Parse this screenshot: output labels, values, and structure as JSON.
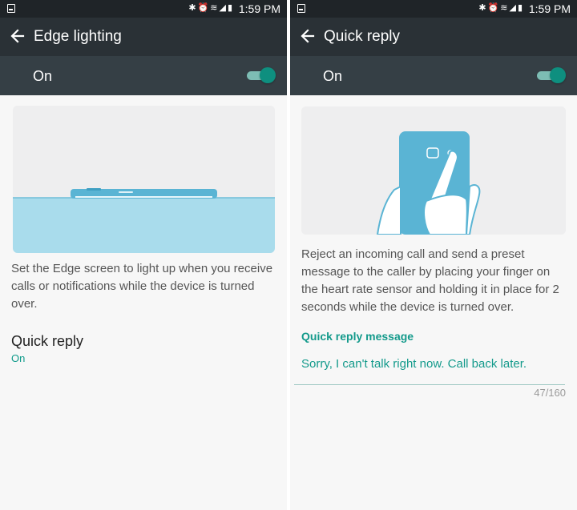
{
  "status_bar": {
    "time": "1:59 PM",
    "icons": [
      "bluetooth-icon",
      "alarm-icon",
      "wifi-icon",
      "signal-icon",
      "battery-icon"
    ]
  },
  "left": {
    "title": "Edge lighting",
    "master_switch": {
      "label": "On",
      "enabled": true
    },
    "description": "Set the Edge screen to light up when you receive calls or notifications while the device is turned over.",
    "quick_reply": {
      "title": "Quick reply",
      "status": "On"
    }
  },
  "right": {
    "title": "Quick reply",
    "master_switch": {
      "label": "On",
      "enabled": true
    },
    "description": "Reject an incoming call and send a preset message to the caller by placing your finger on the heart rate sensor and holding it in place for 2 seconds while the device is turned over.",
    "message_label": "Quick reply message",
    "message_text": "Sorry, I can't talk right now. Call back later.",
    "char_count": "47/160"
  },
  "colors": {
    "status_bar": "#1f2428",
    "app_bar": "#2a3136",
    "switch_bar": "#353f45",
    "accent": "#0e9a8a",
    "illustration_blue": "#5ab4d4"
  }
}
